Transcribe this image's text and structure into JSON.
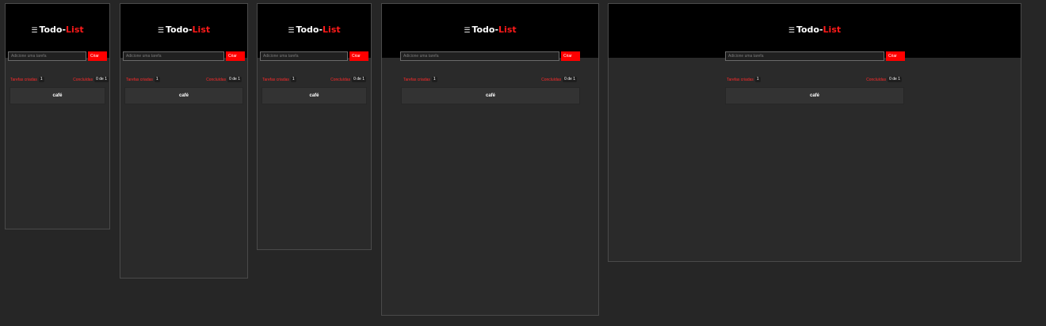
{
  "app": {
    "title_part1": "Todo-",
    "title_part2": "List",
    "input_placeholder": "Adicione uma tarefa",
    "create_button": "Criar",
    "created_label": "Tarefas criadas",
    "created_count": "1",
    "done_label": "Concluídas",
    "done_count": "0 de 1",
    "tasks": [
      "café"
    ]
  },
  "colors": {
    "accent": "#ff0000",
    "header_bg": "#000000",
    "panel_bg": "#2a2a2a",
    "page_bg": "#262626"
  },
  "icons": {
    "logo": "list-icon"
  },
  "previews": [
    "preview-1",
    "preview-2",
    "preview-3",
    "preview-4",
    "preview-5"
  ]
}
